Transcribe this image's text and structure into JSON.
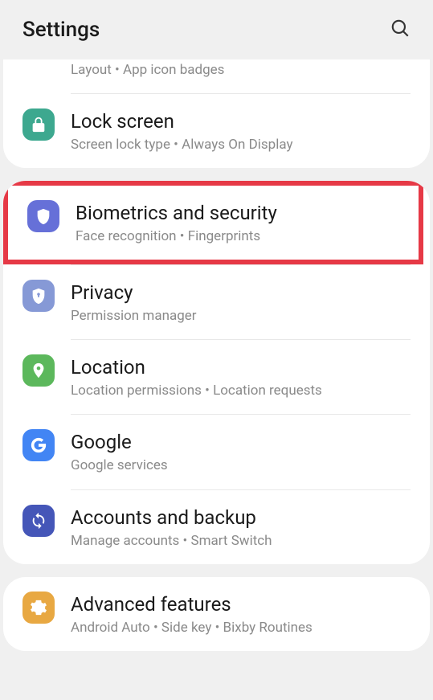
{
  "header": {
    "title": "Settings"
  },
  "items": {
    "homescreen": {
      "subtitle": "Layout  •  App icon badges"
    },
    "lockscreen": {
      "title": "Lock screen",
      "subtitle": "Screen lock type  •  Always On Display"
    },
    "biometrics": {
      "title": "Biometrics and security",
      "subtitle": "Face recognition  •  Fingerprints"
    },
    "privacy": {
      "title": "Privacy",
      "subtitle": "Permission manager"
    },
    "location": {
      "title": "Location",
      "subtitle": "Location permissions  •  Location requests"
    },
    "google": {
      "title": "Google",
      "subtitle": "Google services"
    },
    "accounts": {
      "title": "Accounts and backup",
      "subtitle": "Manage accounts  •  Smart Switch"
    },
    "advanced": {
      "title": "Advanced features",
      "subtitle": "Android Auto  •  Side key  •  Bixby Routines"
    }
  }
}
